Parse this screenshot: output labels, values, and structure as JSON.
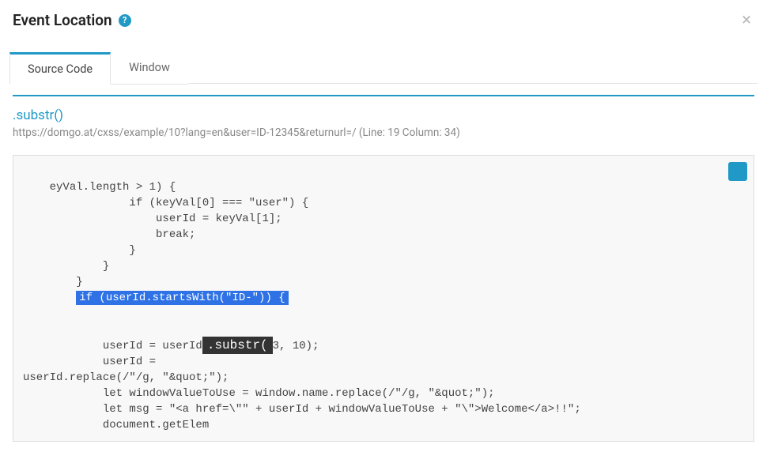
{
  "header": {
    "title": "Event Location",
    "help_glyph": "?"
  },
  "tabs": {
    "source_code": "Source Code",
    "window": "Window"
  },
  "panel": {
    "method": ".substr()",
    "url": "https://domgo.at/cxss/example/10?lang=en&user=ID-12345&returnurl=/ (Line: 19 Column: 34)"
  },
  "code": {
    "l01": "eyVal.length > 1) {",
    "l02": "                if (keyVal[0] === \"user\") {",
    "l03": "                    userId = keyVal[1];",
    "l04": "                    break;",
    "l05": "                }",
    "l06": "            }",
    "l07": "        }",
    "l08_pre": "        ",
    "l08_hl": "if (userId.startsWith(\"ID-\")) {",
    "l09_pre": "            userId = userId",
    "l09_hl": ".substr(",
    "l09_post": "3, 10);",
    "l10": "            userId = ",
    "l11": "userId.replace(/\"/g, \"&quot;\");",
    "l12": "            let windowValueToUse = window.name.replace(/\"/g, \"&quot;\");",
    "l13": "            let msg = \"<a href=\\\"\" + userId + windowValueToUse + \"\\\">Welcome</a>!!\";",
    "l14": "            document.getElem"
  }
}
